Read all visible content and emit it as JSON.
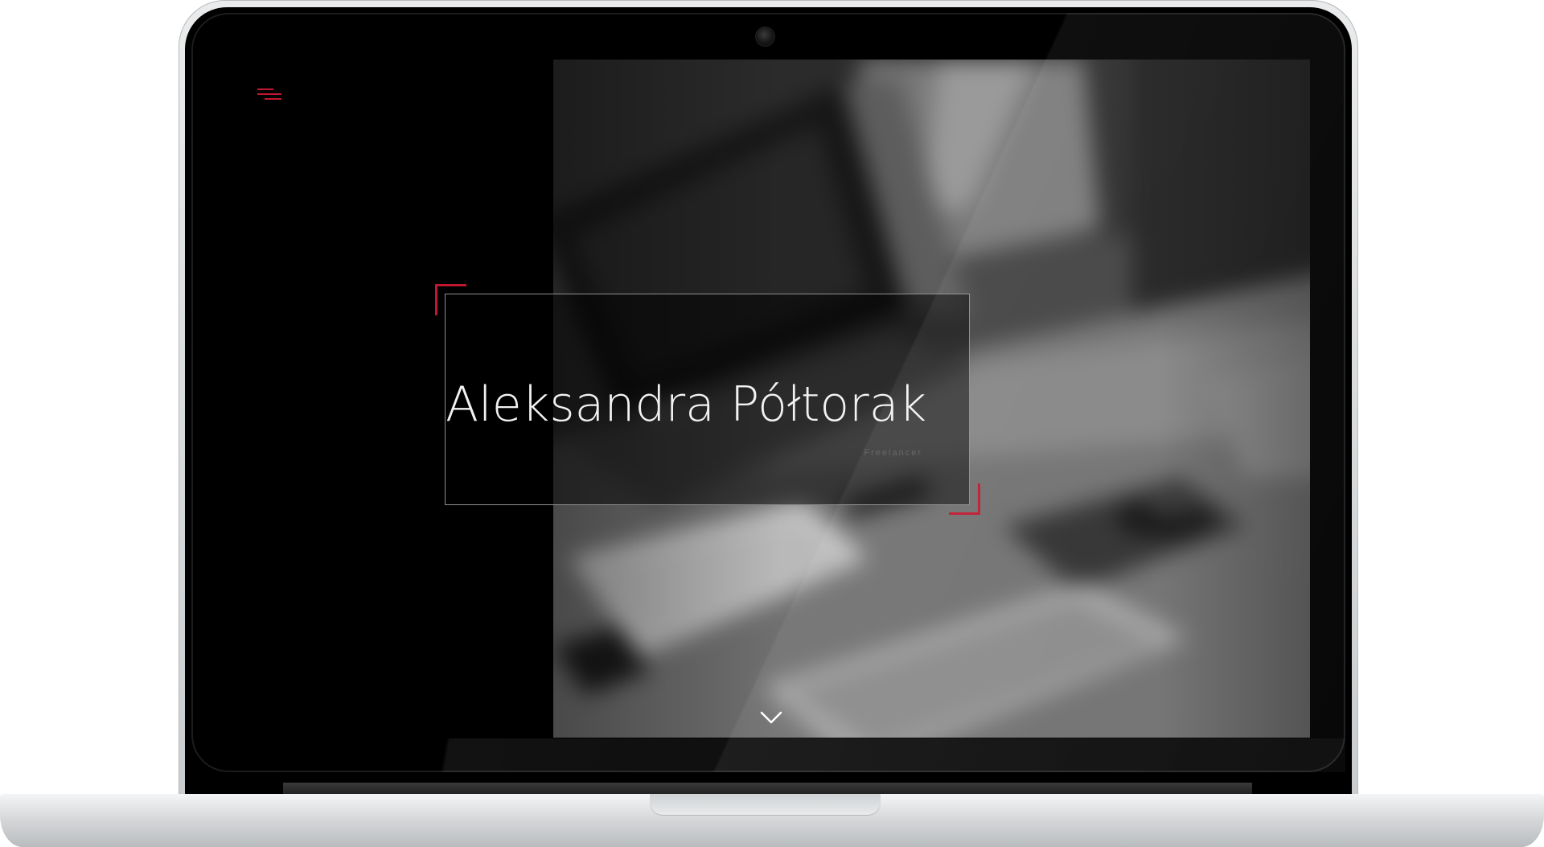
{
  "hero": {
    "name": "Aleksandra Półtorak",
    "subtitle": "Freelancer"
  },
  "icons": {
    "menu": "hamburger-menu-icon",
    "scroll": "chevron-down-icon",
    "camera": "webcam-icon"
  },
  "colors": {
    "accent": "#c0182e",
    "screen_background": "#000000",
    "title_text": "#f2f2f2",
    "subtitle_text": "#5e5e5e",
    "hero_border": "#8f8f8f",
    "device_frame": "#c9ccce"
  }
}
